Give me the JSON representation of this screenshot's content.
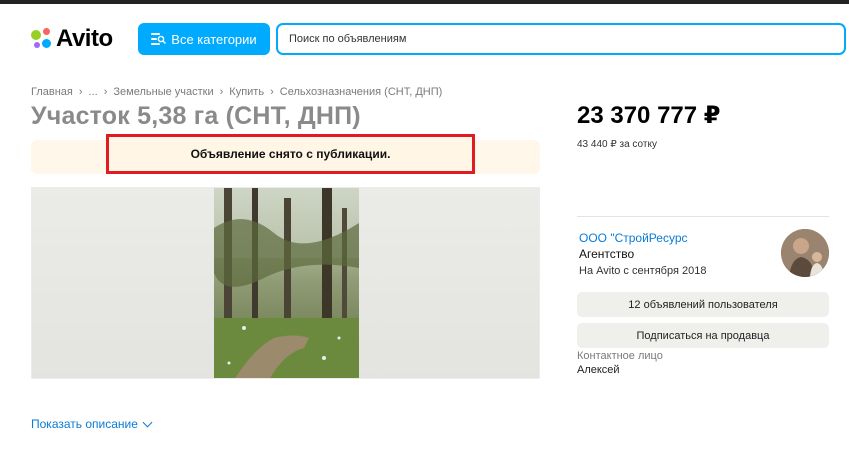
{
  "header": {
    "logo_text": "Avito",
    "categories_button": "Все категории",
    "search_placeholder": "Поиск по объявлениям"
  },
  "breadcrumb": [
    "Главная",
    "...",
    "Земельные участки",
    "Купить",
    "Сельхозназначения (СНТ, ДНП)"
  ],
  "listing": {
    "title": "Участок 5,38 га (СНТ, ДНП)",
    "notice": "Объявление снято с публикации.",
    "show_description": "Показать описание"
  },
  "price": {
    "total": "23 370 777 ₽",
    "per_unit": "43 440 ₽ за сотку"
  },
  "seller": {
    "name": "ООО \"СтройРесурс",
    "type": "Агентство",
    "since": "На Avito с сентября 2018",
    "ads_button": "12 объявлений пользователя",
    "subscribe_button": "Подписаться на продавца",
    "contact_label": "Контактное лицо",
    "contact_name": "Алексей"
  },
  "colors": {
    "accent": "#00aaff",
    "link": "#0a7bd6",
    "notice_border": "#e11b22",
    "notice_bg": "#fff6e6"
  }
}
